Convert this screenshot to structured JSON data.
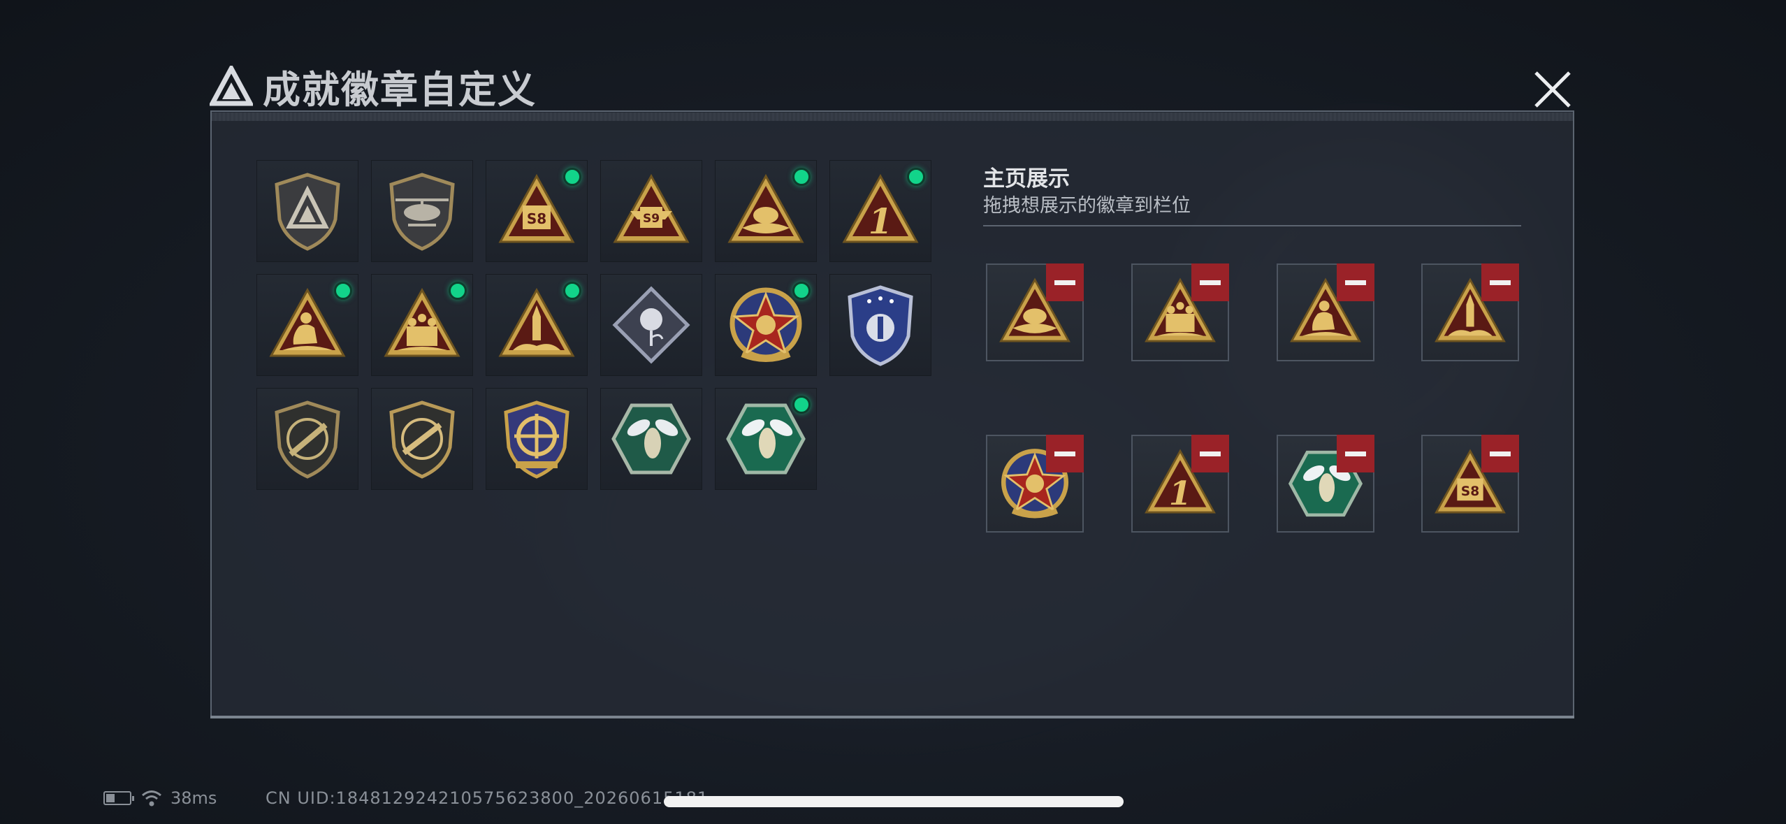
{
  "window": {
    "title": "成就徽章自定义"
  },
  "showcase": {
    "title": "主页展示",
    "subtitle": "拖拽想展示的徽章到栏位"
  },
  "colors": {
    "accent_green": "#12d48a",
    "remove_red": "#9a2228",
    "panel_border": "#5b6470"
  },
  "badges": [
    {
      "icon": "shield-logo-badge-icon",
      "has_dot": false
    },
    {
      "icon": "shield-helicopter-badge-icon",
      "has_dot": false
    },
    {
      "icon": "s8-triangle-badge-icon",
      "has_dot": true
    },
    {
      "icon": "s9-emblem-badge-icon",
      "has_dot": false
    },
    {
      "icon": "hand-triangle-badge-icon",
      "has_dot": true
    },
    {
      "icon": "number-one-triangle-badge-icon",
      "has_dot": true
    },
    {
      "icon": "soldier-triangle-badge-icon",
      "has_dot": true
    },
    {
      "icon": "squad-triangle-badge-icon",
      "has_dot": true
    },
    {
      "icon": "rocket-triangle-badge-icon",
      "has_dot": true
    },
    {
      "icon": "rose-diamond-badge-icon",
      "has_dot": false
    },
    {
      "icon": "star-round-badge-icon",
      "has_dot": true
    },
    {
      "icon": "blue-shield-badge-icon",
      "has_dot": false
    },
    {
      "icon": "rifle-shield-badge-icon",
      "has_dot": false
    },
    {
      "icon": "rifle-shield-gold-badge-icon",
      "has_dot": false
    },
    {
      "icon": "crosshair-shield-badge-icon",
      "has_dot": false
    },
    {
      "icon": "hornet-hexagon-badge-icon",
      "has_dot": false
    },
    {
      "icon": "hornet-hexagon-green-badge-icon",
      "has_dot": true
    }
  ],
  "slots": [
    {
      "icon": "hand-triangle-badge-icon"
    },
    {
      "icon": "squad-triangle-badge-icon"
    },
    {
      "icon": "soldier-triangle-badge-icon"
    },
    {
      "icon": "rocket-triangle-badge-icon"
    },
    {
      "icon": "star-round-badge-icon"
    },
    {
      "icon": "number-one-triangle-badge-icon"
    },
    {
      "icon": "hornet-hexagon-green-badge-icon"
    },
    {
      "icon": "s8-triangle-badge-icon"
    }
  ],
  "status": {
    "ping": "38ms",
    "uid": "CN UID:18481292421057562380​0_20260615181"
  },
  "badge_text": {
    "s8": "S8",
    "s9": "S9",
    "one": "1"
  }
}
